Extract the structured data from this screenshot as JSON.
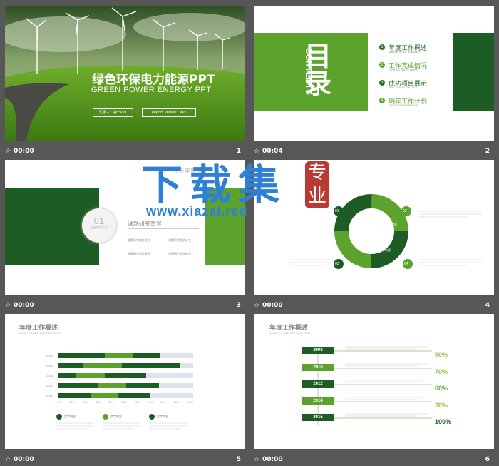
{
  "slides": [
    {
      "number": "1",
      "time": "00:00",
      "title": "绿色环保电力能源PPT",
      "subtitle": "GREEN POWER ENERGY PPT",
      "btn1": "汇报人：第一PPT",
      "btn2": "Report Person：PPT"
    },
    {
      "number": "2",
      "time": "00:04",
      "title_cn": "目录",
      "title_en": "CONTENTS",
      "items": [
        {
          "n": "1",
          "cn": "年度工作概述",
          "en": "ANNUAL WORK SUMMARY"
        },
        {
          "n": "2",
          "cn": "工作完成情况",
          "en": "COMPLETION OF WORK"
        },
        {
          "n": "3",
          "cn": "成功项目展示",
          "en": "SUCCESSFUL PROJECT"
        },
        {
          "n": "4",
          "cn": "明年工作计划",
          "en": "NEXT YEAR WORK PLAN"
        }
      ]
    },
    {
      "number": "3",
      "time": "00:00",
      "chapter_num": "01",
      "chapter_label": "CHAPTER",
      "heading": "课题研究背景",
      "bullets": [
        "课题研究相关补充",
        "课题研究相关补充",
        "课题研究相关补充",
        "课题研究相关补充"
      ],
      "partial_heading": "专业年度概"
    },
    {
      "number": "4",
      "time": "00:00",
      "nums": [
        "01",
        "02",
        "03",
        "04"
      ],
      "segment_label": "文字内容"
    },
    {
      "number": "5",
      "time": "00:00",
      "title": "年度工作概述",
      "subtitle": "CLICK TO ADD CAPTION TEXT",
      "chart_data": {
        "type": "bar",
        "categories": [
          "2015",
          "2014",
          "2013",
          "2012",
          "2011"
        ],
        "ticks": [
          "0%",
          "10%",
          "20%",
          "30%",
          "40%",
          "50%",
          "60%",
          "70%",
          "80%",
          "90%",
          "100%"
        ]
      },
      "legend": [
        "文字内容",
        "文字内容",
        "文字内容"
      ]
    },
    {
      "number": "6",
      "time": "00:00",
      "title": "年度工作概述",
      "subtitle": "CLICK TO ADD CAPTION TEXT",
      "years": [
        "2008",
        "2010",
        "2012",
        "2014",
        "2015"
      ],
      "percents": [
        "50%",
        "70%",
        "60%",
        "30%",
        "100%"
      ]
    }
  ],
  "watermark": {
    "big": "下载集",
    "url": "www.xiazai.red",
    "seal": "专业"
  },
  "colors": {
    "dark_green": "#1e5c25",
    "green": "#5ba32c",
    "light_green": "#8bc540"
  }
}
